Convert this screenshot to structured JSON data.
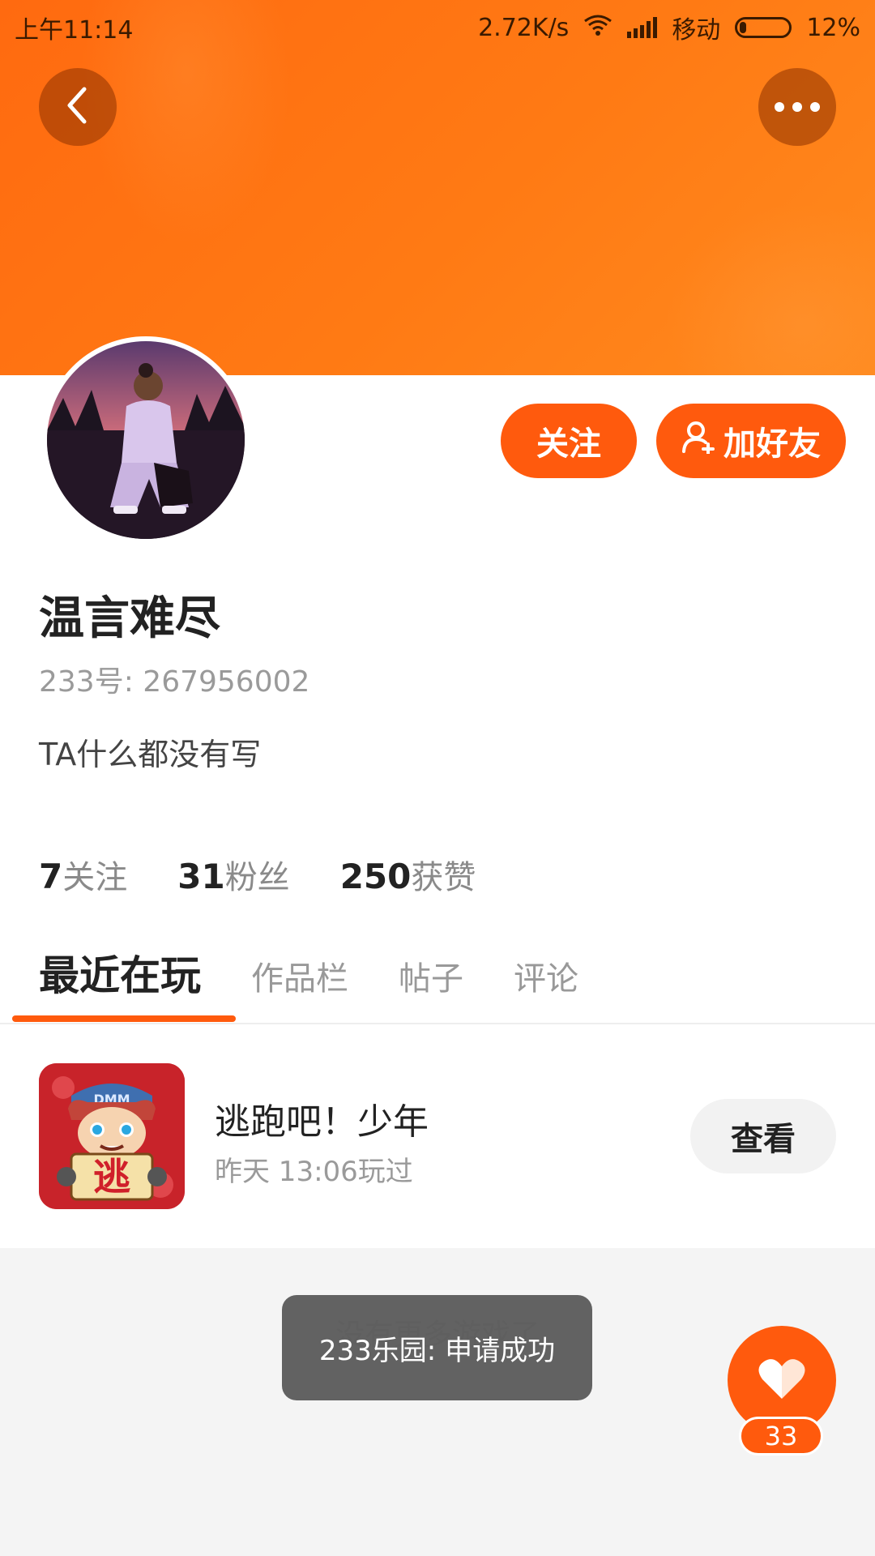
{
  "status_bar": {
    "time": "上午11:14",
    "net_speed": "2.72K/s",
    "carrier": "移动",
    "battery": "12%"
  },
  "header": {
    "back_icon": "chevron-left-icon",
    "more_icon": "more-dots-icon"
  },
  "actions": {
    "follow_label": "关注",
    "add_friend_label": "加好友"
  },
  "profile": {
    "name": "温言难尽",
    "id_text": "233号: 267956002",
    "bio": "TA什么都没有写"
  },
  "stats": [
    {
      "value": "7",
      "label": "关注"
    },
    {
      "value": "31",
      "label": "粉丝"
    },
    {
      "value": "250",
      "label": "获赞"
    }
  ],
  "tabs": [
    {
      "label": "最近在玩",
      "active": true
    },
    {
      "label": "作品栏",
      "active": false
    },
    {
      "label": "帖子",
      "active": false
    },
    {
      "label": "评论",
      "active": false
    }
  ],
  "games": [
    {
      "title": "逃跑吧！少年",
      "played": "昨天 13:06玩过",
      "view_label": "查看",
      "icon_text": "逃",
      "cap_text": "DMM"
    }
  ],
  "list_end_text": "没有更多游戏了",
  "toast": "233乐园: 申请成功",
  "like": {
    "count": "33",
    "icon": "heart-icon"
  },
  "colors": {
    "accent": "#ff5a0d",
    "banner": "#ff7a14"
  }
}
